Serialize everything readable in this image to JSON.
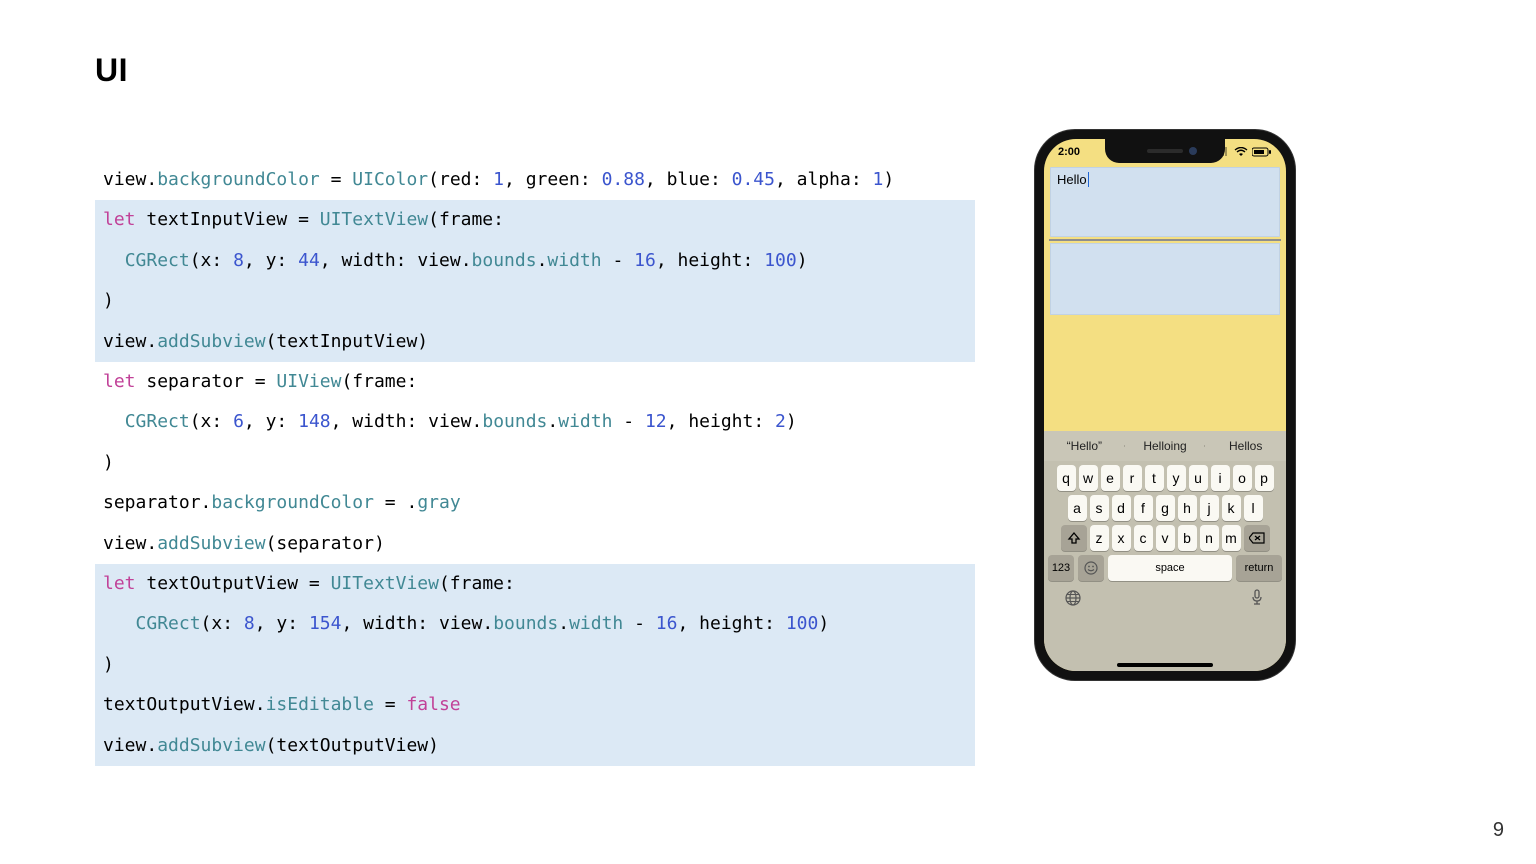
{
  "title": "UI",
  "page_number": "9",
  "code": {
    "lines": [
      {
        "hl": false,
        "tokens": [
          [
            "id",
            "view"
          ],
          [
            "punct",
            "."
          ],
          [
            "prop",
            "backgroundColor"
          ],
          [
            "punct",
            " = "
          ],
          [
            "call",
            "UIColor"
          ],
          [
            "punct",
            "(red: "
          ],
          [
            "num",
            "1"
          ],
          [
            "punct",
            ", green: "
          ],
          [
            "num",
            "0.88"
          ],
          [
            "punct",
            ", blue: "
          ],
          [
            "num",
            "0.45"
          ],
          [
            "punct",
            ", alpha: "
          ],
          [
            "num",
            "1"
          ],
          [
            "punct",
            ")"
          ]
        ]
      },
      {
        "hl": true,
        "tokens": [
          [
            "kw",
            "let"
          ],
          [
            "punct",
            " textInputView = "
          ],
          [
            "call",
            "UITextView"
          ],
          [
            "punct",
            "(frame:"
          ]
        ]
      },
      {
        "hl": true,
        "tokens": [
          [
            "punct",
            "  "
          ],
          [
            "call",
            "CGRect"
          ],
          [
            "punct",
            "(x: "
          ],
          [
            "num",
            "8"
          ],
          [
            "punct",
            ", y: "
          ],
          [
            "num",
            "44"
          ],
          [
            "punct",
            ", width: "
          ],
          [
            "id",
            "view"
          ],
          [
            "punct",
            "."
          ],
          [
            "prop",
            "bounds"
          ],
          [
            "punct",
            "."
          ],
          [
            "prop",
            "width"
          ],
          [
            "punct",
            " - "
          ],
          [
            "num",
            "16"
          ],
          [
            "punct",
            ", height: "
          ],
          [
            "num",
            "100"
          ],
          [
            "punct",
            ")"
          ]
        ]
      },
      {
        "hl": true,
        "tokens": [
          [
            "punct",
            ")"
          ]
        ]
      },
      {
        "hl": true,
        "tokens": [
          [
            "id",
            "view"
          ],
          [
            "punct",
            "."
          ],
          [
            "call",
            "addSubview"
          ],
          [
            "punct",
            "(textInputView)"
          ]
        ]
      },
      {
        "hl": false,
        "tokens": [
          [
            "kw",
            "let"
          ],
          [
            "punct",
            " separator = "
          ],
          [
            "call",
            "UIView"
          ],
          [
            "punct",
            "(frame:"
          ]
        ]
      },
      {
        "hl": false,
        "tokens": [
          [
            "punct",
            "  "
          ],
          [
            "call",
            "CGRect"
          ],
          [
            "punct",
            "(x: "
          ],
          [
            "num",
            "6"
          ],
          [
            "punct",
            ", y: "
          ],
          [
            "num",
            "148"
          ],
          [
            "punct",
            ", width: "
          ],
          [
            "id",
            "view"
          ],
          [
            "punct",
            "."
          ],
          [
            "prop",
            "bounds"
          ],
          [
            "punct",
            "."
          ],
          [
            "prop",
            "width"
          ],
          [
            "punct",
            " - "
          ],
          [
            "num",
            "12"
          ],
          [
            "punct",
            ", height: "
          ],
          [
            "num",
            "2"
          ],
          [
            "punct",
            ")"
          ]
        ]
      },
      {
        "hl": false,
        "tokens": [
          [
            "punct",
            ")"
          ]
        ]
      },
      {
        "hl": false,
        "tokens": [
          [
            "id",
            "separator"
          ],
          [
            "punct",
            "."
          ],
          [
            "prop",
            "backgroundColor"
          ],
          [
            "punct",
            " = ."
          ],
          [
            "enum",
            "gray"
          ]
        ]
      },
      {
        "hl": false,
        "tokens": [
          [
            "id",
            "view"
          ],
          [
            "punct",
            "."
          ],
          [
            "call",
            "addSubview"
          ],
          [
            "punct",
            "(separator)"
          ]
        ]
      },
      {
        "hl": true,
        "tokens": [
          [
            "kw",
            "let"
          ],
          [
            "punct",
            " textOutputView = "
          ],
          [
            "call",
            "UITextView"
          ],
          [
            "punct",
            "(frame:"
          ]
        ]
      },
      {
        "hl": true,
        "tokens": [
          [
            "punct",
            "   "
          ],
          [
            "call",
            "CGRect"
          ],
          [
            "punct",
            "(x: "
          ],
          [
            "num",
            "8"
          ],
          [
            "punct",
            ", y: "
          ],
          [
            "num",
            "154"
          ],
          [
            "punct",
            ", width: "
          ],
          [
            "id",
            "view"
          ],
          [
            "punct",
            "."
          ],
          [
            "prop",
            "bounds"
          ],
          [
            "punct",
            "."
          ],
          [
            "prop",
            "width"
          ],
          [
            "punct",
            " - "
          ],
          [
            "num",
            "16"
          ],
          [
            "punct",
            ", height: "
          ],
          [
            "num",
            "100"
          ],
          [
            "punct",
            ")"
          ]
        ]
      },
      {
        "hl": true,
        "tokens": [
          [
            "punct",
            ")"
          ]
        ]
      },
      {
        "hl": true,
        "tokens": [
          [
            "id",
            "textOutputView"
          ],
          [
            "punct",
            "."
          ],
          [
            "prop",
            "isEditable"
          ],
          [
            "punct",
            " = "
          ],
          [
            "kw",
            "false"
          ]
        ]
      },
      {
        "hl": true,
        "tokens": [
          [
            "id",
            "view"
          ],
          [
            "punct",
            "."
          ],
          [
            "call",
            "addSubview"
          ],
          [
            "punct",
            "(textOutputView)"
          ]
        ]
      }
    ]
  },
  "phone": {
    "status_time": "2:00",
    "text_input": "Hello",
    "suggestions": [
      "“Hello”",
      "Helloing",
      "Hellos"
    ],
    "row1": [
      "q",
      "w",
      "e",
      "r",
      "t",
      "y",
      "u",
      "i",
      "o",
      "p"
    ],
    "row2": [
      "a",
      "s",
      "d",
      "f",
      "g",
      "h",
      "j",
      "k",
      "l"
    ],
    "row3": [
      "z",
      "x",
      "c",
      "v",
      "b",
      "n",
      "m"
    ],
    "row4_num": "123",
    "row4_space": "space",
    "row4_return": "return"
  }
}
